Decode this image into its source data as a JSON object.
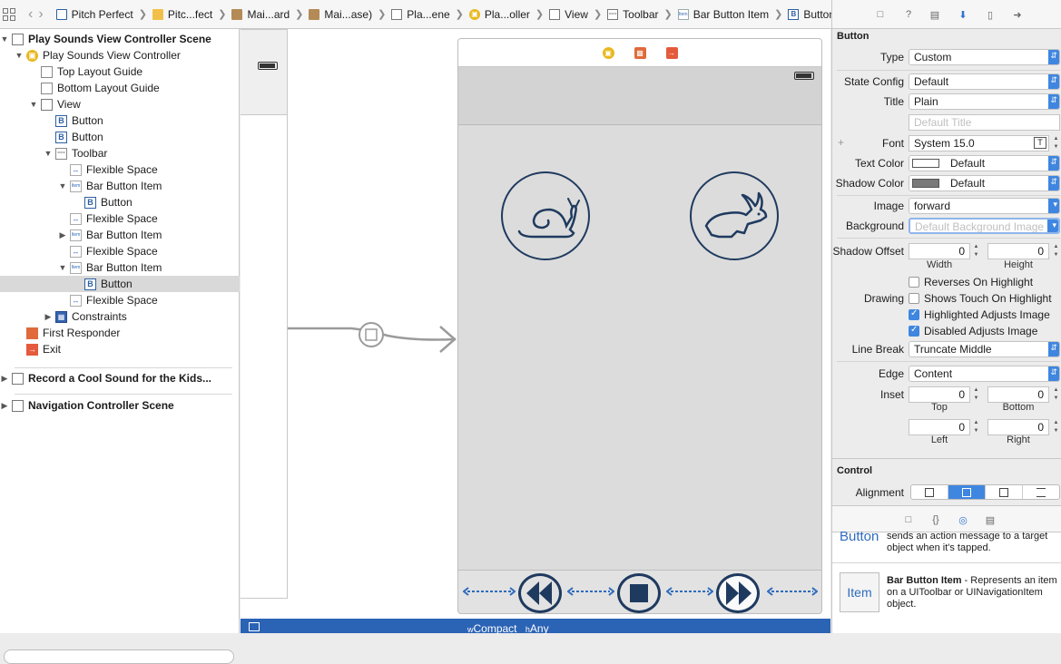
{
  "breadcrumb": [
    {
      "label": "Pitch Perfect",
      "icon": "project-icon"
    },
    {
      "label": "Pitc...fect",
      "icon": "folder-icon"
    },
    {
      "label": "Mai...ard",
      "icon": "storyboard-icon"
    },
    {
      "label": "Mai...ase)",
      "icon": "storyboard-icon"
    },
    {
      "label": "Pla...ene",
      "icon": "scene-icon"
    },
    {
      "label": "Pla...oller",
      "icon": "view-controller-icon"
    },
    {
      "label": "View",
      "icon": "view-icon"
    },
    {
      "label": "Toolbar",
      "icon": "toolbar-icon"
    },
    {
      "label": "Bar Button Item",
      "icon": "bar-button-item-icon"
    },
    {
      "label": "Button",
      "icon": "button-icon"
    }
  ],
  "outline": {
    "rows": [
      {
        "label": "Play Sounds View Controller Scene",
        "bold": true
      },
      {
        "label": "Play Sounds View Controller"
      },
      {
        "label": "Top Layout Guide"
      },
      {
        "label": "Bottom Layout Guide"
      },
      {
        "label": "View"
      },
      {
        "label": "Button"
      },
      {
        "label": "Button"
      },
      {
        "label": "Toolbar"
      },
      {
        "label": "Flexible Space"
      },
      {
        "label": "Bar Button Item"
      },
      {
        "label": "Button"
      },
      {
        "label": "Flexible Space"
      },
      {
        "label": "Bar Button Item"
      },
      {
        "label": "Flexible Space"
      },
      {
        "label": "Bar Button Item"
      },
      {
        "label": "Button"
      },
      {
        "label": "Flexible Space"
      },
      {
        "label": "Constraints"
      },
      {
        "label": "First Responder"
      },
      {
        "label": "Exit"
      },
      {
        "label": "Record a Cool Sound for the Kids...",
        "bold": true
      },
      {
        "label": "Navigation Controller Scene",
        "bold": true
      }
    ]
  },
  "canvas": {
    "size_class_w": "Compact",
    "size_class_h": "Any",
    "size_class_w_prefix": "w",
    "size_class_h_prefix": "h"
  },
  "inspector": {
    "section_button": "Button",
    "type_label": "Type",
    "type_value": "Custom",
    "state_label": "State Config",
    "state_value": "Default",
    "title_label": "Title",
    "title_value": "Plain",
    "title_placeholder": "Default Title",
    "font_label": "Font",
    "font_value": "System 15.0",
    "text_color_label": "Text Color",
    "text_color_value": "Default",
    "shadow_color_label": "Shadow Color",
    "shadow_color_value": "Default",
    "image_label": "Image",
    "image_value": "forward",
    "background_label": "Background",
    "background_placeholder": "Default Background Image",
    "shadow_offset_label": "Shadow Offset",
    "shadow_w": "0",
    "shadow_h": "0",
    "width_caption": "Width",
    "height_caption": "Height",
    "drawing_label": "Drawing",
    "reverses": "Reverses On Highlight",
    "shows_touch": "Shows Touch On Highlight",
    "highlighted_adj": "Highlighted Adjusts Image",
    "disabled_adj": "Disabled Adjusts Image",
    "line_break_label": "Line Break",
    "line_break_value": "Truncate Middle",
    "edge_label": "Edge",
    "edge_value": "Content",
    "inset_label": "Inset",
    "inset_top": "0",
    "inset_bottom": "0",
    "inset_left": "0",
    "inset_right": "0",
    "top_caption": "Top",
    "bottom_caption": "Bottom",
    "left_caption": "Left",
    "right_caption": "Right",
    "section_control": "Control",
    "alignment_label": "Alignment",
    "plus": "+"
  },
  "library": {
    "button_title": "Button",
    "button_desc": "sends an action message to a target object when it's tapped.",
    "item_icon_text": "Item",
    "item_title": "Bar Button Item",
    "item_desc": " - Represents an item on a UIToolbar or UINavigationItem object."
  },
  "colors": {
    "accent": "#3f86e0",
    "nav_dark": "#1f3a5f",
    "status_bar": "#2b63b5"
  }
}
